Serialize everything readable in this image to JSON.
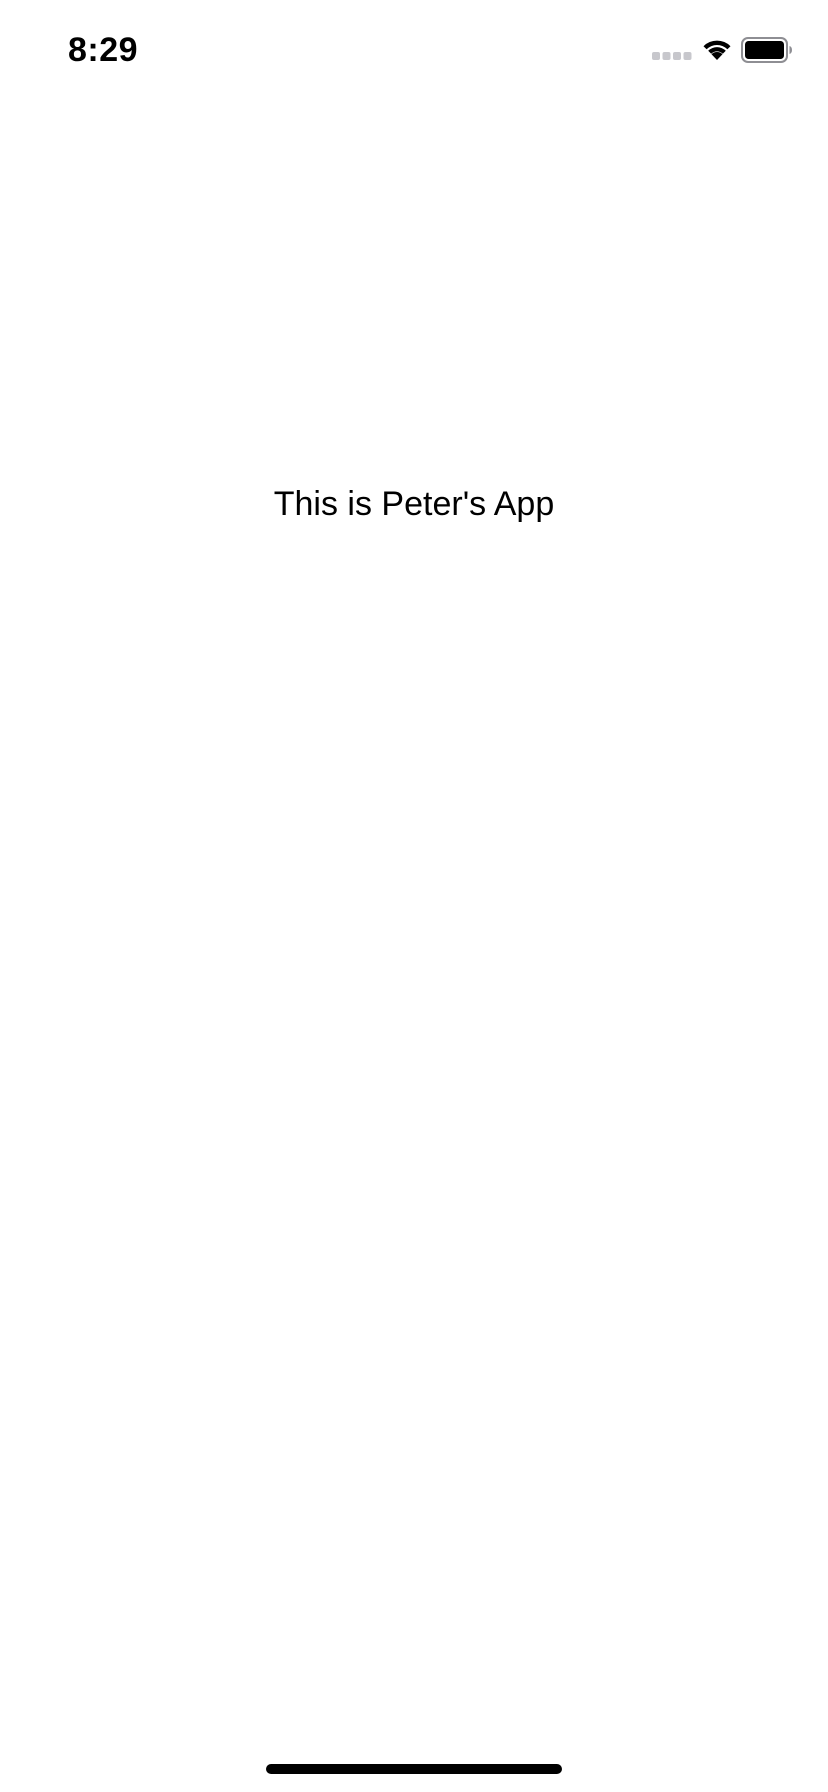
{
  "status_bar": {
    "time": "8:29",
    "signal_icon": "cellular-signal-icon",
    "wifi_icon": "wifi-icon",
    "battery_icon": "battery-full-icon"
  },
  "main": {
    "title": "This is Peter's App"
  },
  "colors": {
    "background": "#ffffff",
    "text": "#000000",
    "signal_inactive": "#c7c7cc"
  }
}
